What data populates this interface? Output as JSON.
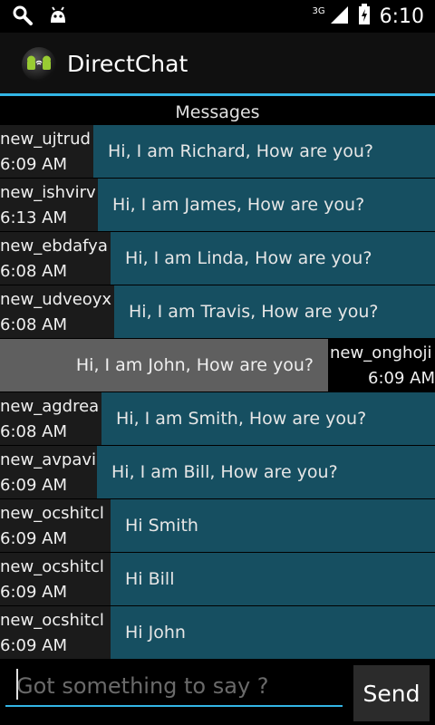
{
  "status_bar": {
    "left_icons": [
      "search-icon",
      "android-icon"
    ],
    "network_label": "3G",
    "time": "6:10"
  },
  "app": {
    "title": "DirectChat"
  },
  "list_header": "Messages",
  "messages": [
    {
      "user": "new_ujtrud",
      "time": "6:09 AM",
      "text": "Hi, I am Richard, How are you?",
      "outgoing": false
    },
    {
      "user": "new_ishvirv",
      "time": "6:13 AM",
      "text": "Hi, I am James, How are you?",
      "outgoing": false
    },
    {
      "user": "new_ebdafya",
      "time": "6:08 AM",
      "text": "Hi, I am Linda, How are you?",
      "outgoing": false
    },
    {
      "user": "new_udveoyx",
      "time": "6:08 AM",
      "text": "Hi, I am Travis, How are you?",
      "outgoing": false
    },
    {
      "user": "new_onghoji",
      "time": "6:09 AM",
      "text": "Hi, I am John, How are you?",
      "outgoing": true
    },
    {
      "user": "new_agdrea",
      "time": "6:08 AM",
      "text": "Hi, I am Smith, How are you?",
      "outgoing": false
    },
    {
      "user": "new_avpavi",
      "time": "6:09 AM",
      "text": "Hi, I am Bill, How are you?",
      "outgoing": false
    },
    {
      "user": "new_ocshitcl",
      "time": "6:09 AM",
      "text": "Hi Smith",
      "outgoing": false
    },
    {
      "user": "new_ocshitcl",
      "time": "6:09 AM",
      "text": "Hi Bill",
      "outgoing": false
    },
    {
      "user": "new_ocshitcl",
      "time": "6:09 AM",
      "text": "Hi John",
      "outgoing": false
    }
  ],
  "composer": {
    "placeholder": "Got something to say ?",
    "value": "",
    "send_label": "Send"
  },
  "colors": {
    "accent": "#33b5e5",
    "incoming_bubble": "#164f61",
    "outgoing_bubble": "#5f5f5f"
  }
}
